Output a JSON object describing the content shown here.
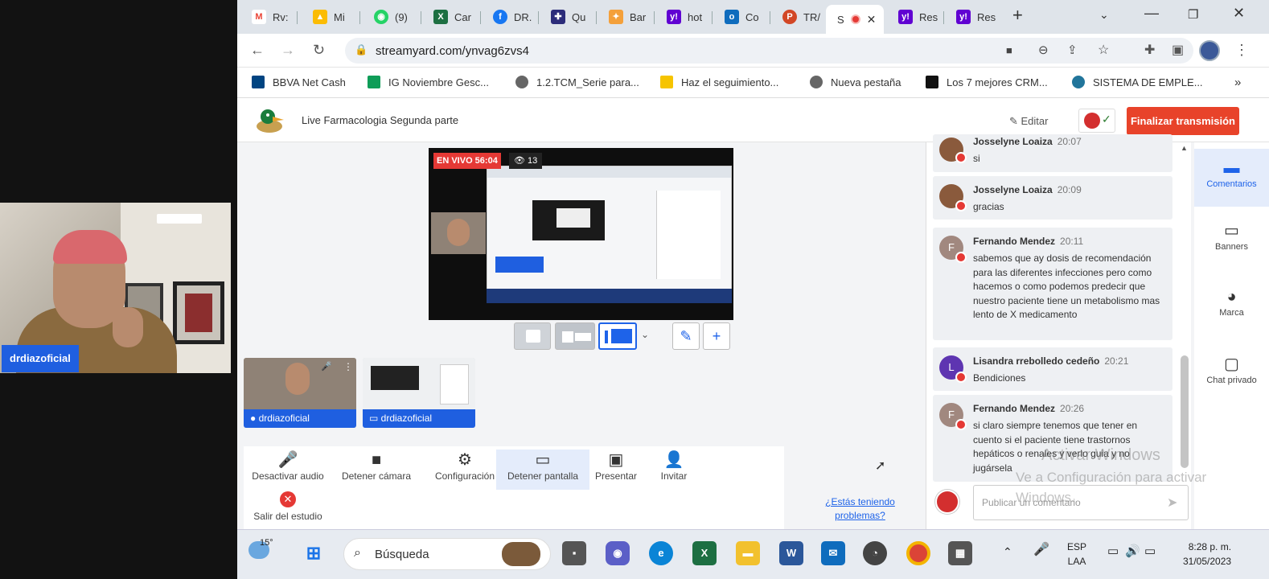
{
  "camera": {
    "name": "drdiazoficial"
  },
  "tabs": [
    {
      "label": "Rv:",
      "icon": "gmail-icon",
      "color": "#ea4335"
    },
    {
      "label": "Mi",
      "icon": "drive-icon",
      "color": "#1a73e8"
    },
    {
      "label": "(9)",
      "icon": "whatsapp-icon",
      "color": "#25d366"
    },
    {
      "label": "Car",
      "icon": "excel-icon",
      "color": "#1d6f42"
    },
    {
      "label": "DR.",
      "icon": "facebook-icon",
      "color": "#1877f2"
    },
    {
      "label": "Qu",
      "icon": "quiz-icon",
      "color": "#2c2c7a"
    },
    {
      "label": "Bar",
      "icon": "star-icon",
      "color": "#f4a03a"
    },
    {
      "label": "hot",
      "icon": "yahoo-icon",
      "color": "#6001d2"
    },
    {
      "label": "Co",
      "icon": "outlook-icon",
      "color": "#0f6cbd"
    },
    {
      "label": "TR/",
      "icon": "powerpoint-icon",
      "color": "#d24726"
    },
    {
      "label": "S",
      "icon": "streamyard-icon",
      "color": "#e53935"
    },
    {
      "label": "Res",
      "icon": "yahoo-icon",
      "color": "#6001d2"
    },
    {
      "label": "Res",
      "icon": "yahoo-icon",
      "color": "#6001d2"
    }
  ],
  "address": {
    "url": "streamyard.com/ynvag6zvs4"
  },
  "bookmarks": [
    {
      "label": "BBVA Net Cash",
      "color": "#004481"
    },
    {
      "label": "IG Noviembre Gesc...",
      "color": "#0f9d58"
    },
    {
      "label": "1.2.TCM_Serie para...",
      "color": "#666666"
    },
    {
      "label": "Haz el seguimiento...",
      "color": "#f6c400"
    },
    {
      "label": "Nueva pestaña",
      "color": "#666666"
    },
    {
      "label": "Los 7 mejores CRM...",
      "color": "#111111"
    },
    {
      "label": "SISTEMA DE EMPLE...",
      "color": "#21759b"
    }
  ],
  "studio": {
    "title": "Live Farmacologia Segunda parte",
    "edit_label": "Editar",
    "finish_label": "Finalizar transmisión",
    "live_label": "EN VIVO 56:04",
    "viewers": "13"
  },
  "thumbs": [
    {
      "label": "drdiazoficial"
    },
    {
      "label": "drdiazoficial"
    }
  ],
  "toolbar": {
    "items": [
      {
        "label": "Desactivar audio",
        "icon": "microphone-icon",
        "glyph": "🎤"
      },
      {
        "label": "Detener cámara",
        "icon": "camera-icon",
        "glyph": "■"
      },
      {
        "label": "Configuración",
        "icon": "gear-icon",
        "glyph": "⚙"
      },
      {
        "label": "Detener pantalla",
        "icon": "monitor-icon",
        "glyph": "🖥"
      },
      {
        "label": "Presentar",
        "icon": "present-icon",
        "glyph": "▣"
      },
      {
        "label": "Invitar",
        "icon": "add-user-icon",
        "glyph": "👤"
      }
    ],
    "exit_label": "Salir del estudio"
  },
  "problems_link": "¿Estás teniendo problemas?",
  "chat": {
    "messages": [
      {
        "name": "Josselyne Loaiza",
        "time": "20:07",
        "text": "si",
        "avatar": "#8a5a3c"
      },
      {
        "name": "Josselyne Loaiza",
        "time": "20:09",
        "text": "gracias",
        "avatar": "#8a5a3c"
      },
      {
        "name": "Fernando Mendez",
        "time": "20:11",
        "text": "sabemos que ay dosis de recomendación para las diferentes infecciones pero como hacemos o como podemos predecir que nuestro paciente tiene un metabolismo mas lento de X medicamento",
        "avatar": "#a1887f",
        "initial": "F"
      },
      {
        "name": "Lisandra rrebolledo cedeño",
        "time": "20:21",
        "text": "Bendiciones",
        "avatar": "#5e35b1",
        "initial": "L"
      },
      {
        "name": "Fernando Mendez",
        "time": "20:26",
        "text": "si claro siempre tenemos que tener en cuento si el paciente tiene trastornos hepáticos o renales y verlo guia y no jugársela",
        "avatar": "#a1887f",
        "initial": "F"
      }
    ],
    "composer_placeholder": "Publicar un comentario"
  },
  "side": [
    {
      "label": "Comentarios",
      "icon": "comment-icon",
      "glyph": "▬"
    },
    {
      "label": "Banners",
      "icon": "banner-icon",
      "glyph": "▭"
    },
    {
      "label": "Marca",
      "icon": "palette-icon",
      "glyph": "🎨"
    },
    {
      "label": "Chat privado",
      "icon": "chat-icon",
      "glyph": "▢"
    }
  ],
  "watermark": {
    "line1": "Activar Windows",
    "line2": "Ve a Configuración para activar",
    "line3": "Windows."
  },
  "taskbar": {
    "weather": "15°",
    "search": "Búsqueda",
    "lang1": "ESP",
    "lang2": "LAA",
    "time": "8:28 p. m.",
    "date": "31/05/2023"
  }
}
